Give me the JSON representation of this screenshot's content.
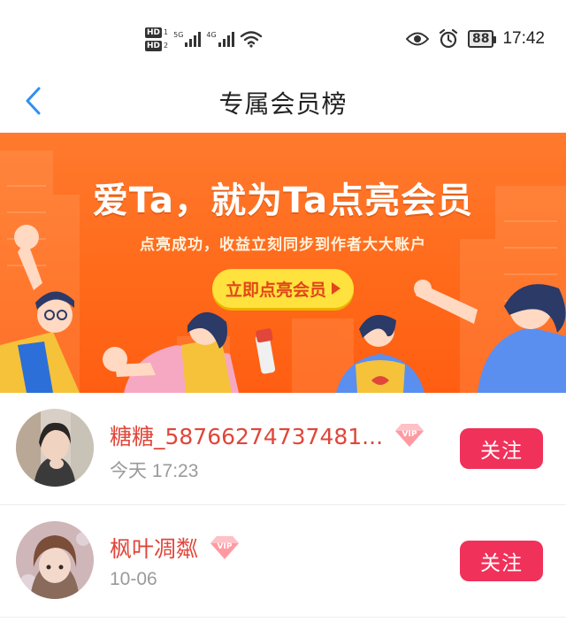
{
  "status_bar": {
    "hd1": "HD",
    "hd1_sub": "1",
    "hd2": "HD",
    "hd2_sub": "2",
    "net1": "5G",
    "net2": "4G",
    "battery": "88",
    "time": "17:42",
    "icons": [
      "eye-icon",
      "alarm-icon",
      "wifi-icon",
      "signal-icon"
    ]
  },
  "nav": {
    "title": "专属会员榜",
    "back_icon": "chevron-left-icon",
    "accent": "#2e8ff5"
  },
  "banner": {
    "headline": "爱Ta，就为Ta点亮会员",
    "subtitle": "点亮成功，收益立刻同步到作者大大账户",
    "cta": "立即点亮会员"
  },
  "members": [
    {
      "name": "糖糖_58766274737481...",
      "time": "今天 17:23",
      "badge": "VIP",
      "follow": "关注"
    },
    {
      "name": "枫叶凋粼",
      "time": "10-06",
      "badge": "VIP",
      "follow": "关注"
    }
  ],
  "colors": {
    "name": "#e0463a",
    "follow_bg": "#f0315a",
    "banner": "#ff6a1a",
    "cta_bg": "#ffe23d"
  }
}
